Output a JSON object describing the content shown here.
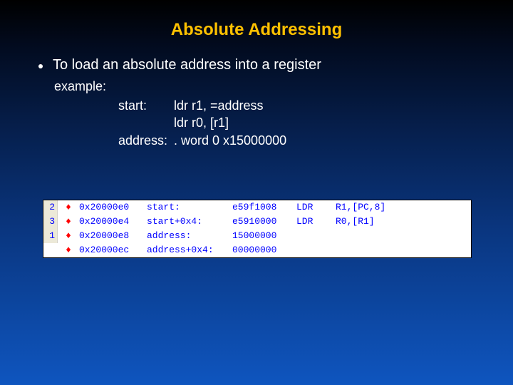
{
  "title": "Absolute Addressing",
  "bullet_text": "To load an absolute address into a register",
  "example_label": "example:",
  "code": {
    "rows": [
      {
        "label": "start:",
        "instr": "ldr r1, =address"
      },
      {
        "label": "",
        "instr": "ldr r0, [r1]"
      },
      {
        "label": "address:",
        "instr": ". word 0 x15000000"
      }
    ]
  },
  "listing": {
    "rows": [
      {
        "line": "2",
        "bp": "♦",
        "addr": "0x20000e0",
        "label": "start:",
        "enc": "e59f1008",
        "mn": "LDR",
        "ops": "R1,[PC,8]"
      },
      {
        "line": "3",
        "bp": "♦",
        "addr": "0x20000e4",
        "label": "start+0x4:",
        "enc": "e5910000",
        "mn": "LDR",
        "ops": "R0,[R1]"
      },
      {
        "line": "1",
        "bp": "♦",
        "addr": "0x20000e8",
        "label": "address:",
        "enc": "15000000",
        "mn": "",
        "ops": ""
      },
      {
        "line": "",
        "bp": "♦",
        "addr": "0x20000ec",
        "label": "address+0x4:",
        "enc": "00000000",
        "mn": "",
        "ops": ""
      }
    ]
  }
}
